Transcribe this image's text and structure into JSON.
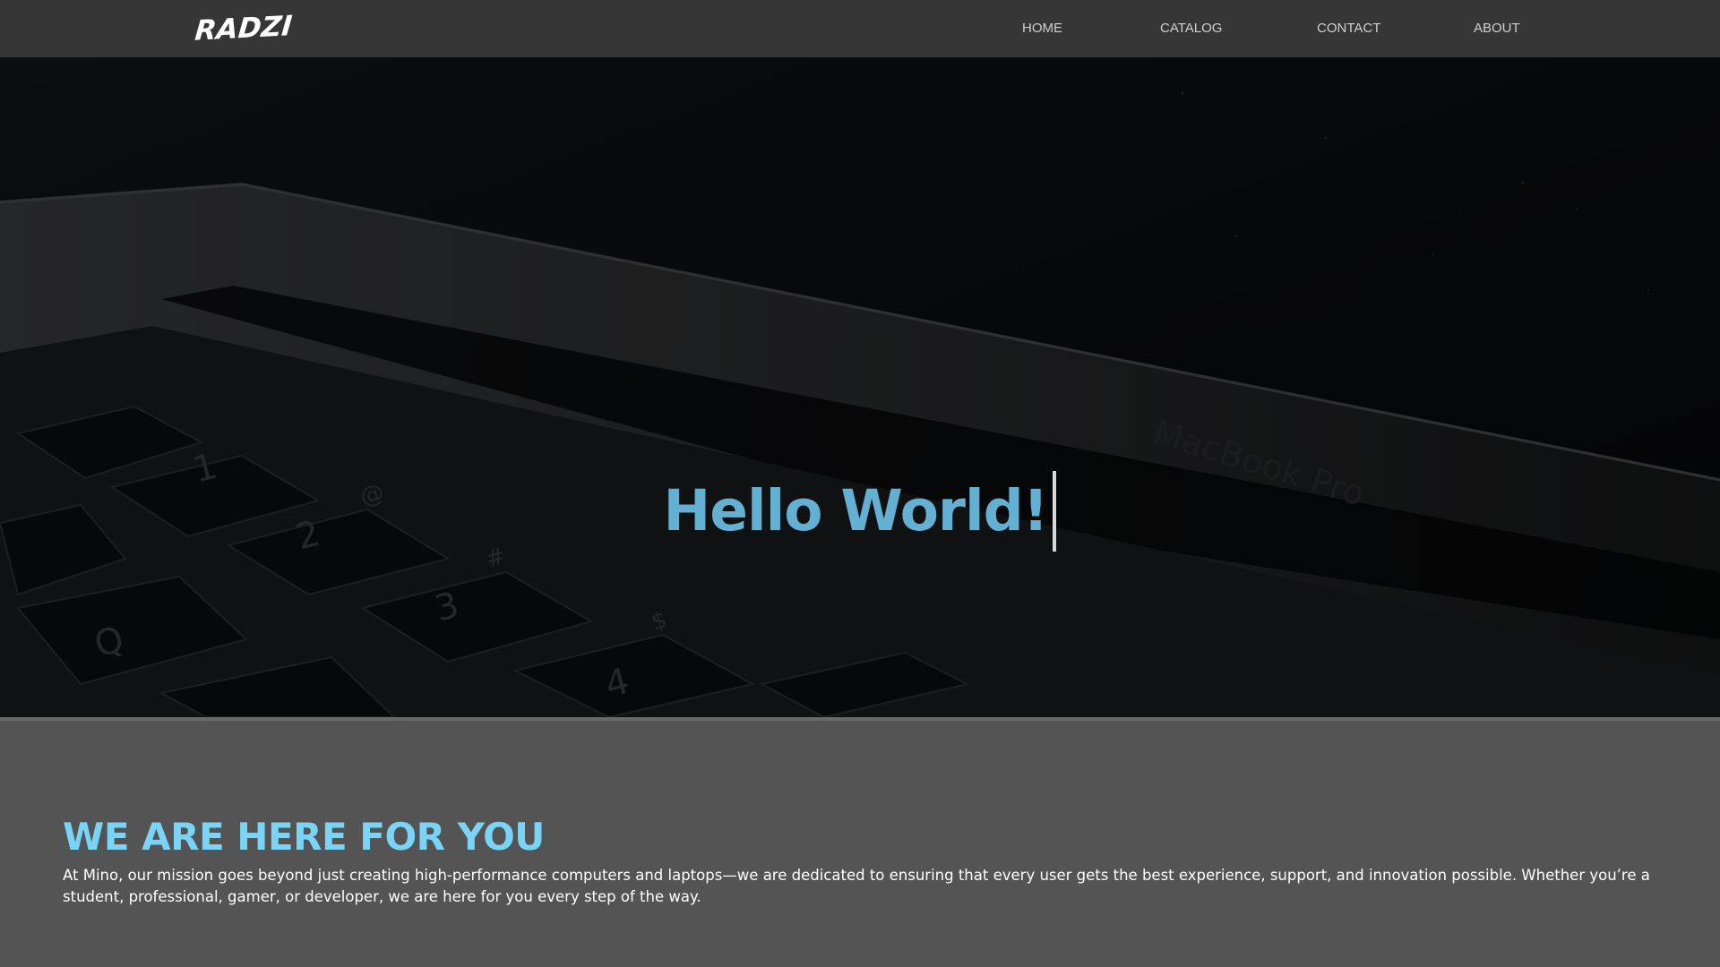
{
  "navbar": {
    "logo": "RADZI",
    "items": [
      {
        "label": "HOME"
      },
      {
        "label": "CATALOG"
      },
      {
        "label": "CONTACT"
      },
      {
        "label": "ABOUT"
      }
    ]
  },
  "hero": {
    "title": "Hello World!",
    "background_image": "macbook-keyboard-photo",
    "background_text": "MacBook Pro"
  },
  "about": {
    "heading": "WE ARE HERE FOR YOU",
    "text": "At Mino, our mission goes beyond just creating high-performance computers and laptops—we are dedicated to ensuring that every user gets the best experience, support, and innovation possible. Whether you’re a student, professional, gamer, or developer, we are here for you every step of the way."
  },
  "colors": {
    "navbar_bg": "#363636",
    "accent_title": "#63b0d2",
    "accent_heading": "#79d4f5",
    "section_bg": "#545454",
    "nav_text": "#cfcfcf"
  }
}
